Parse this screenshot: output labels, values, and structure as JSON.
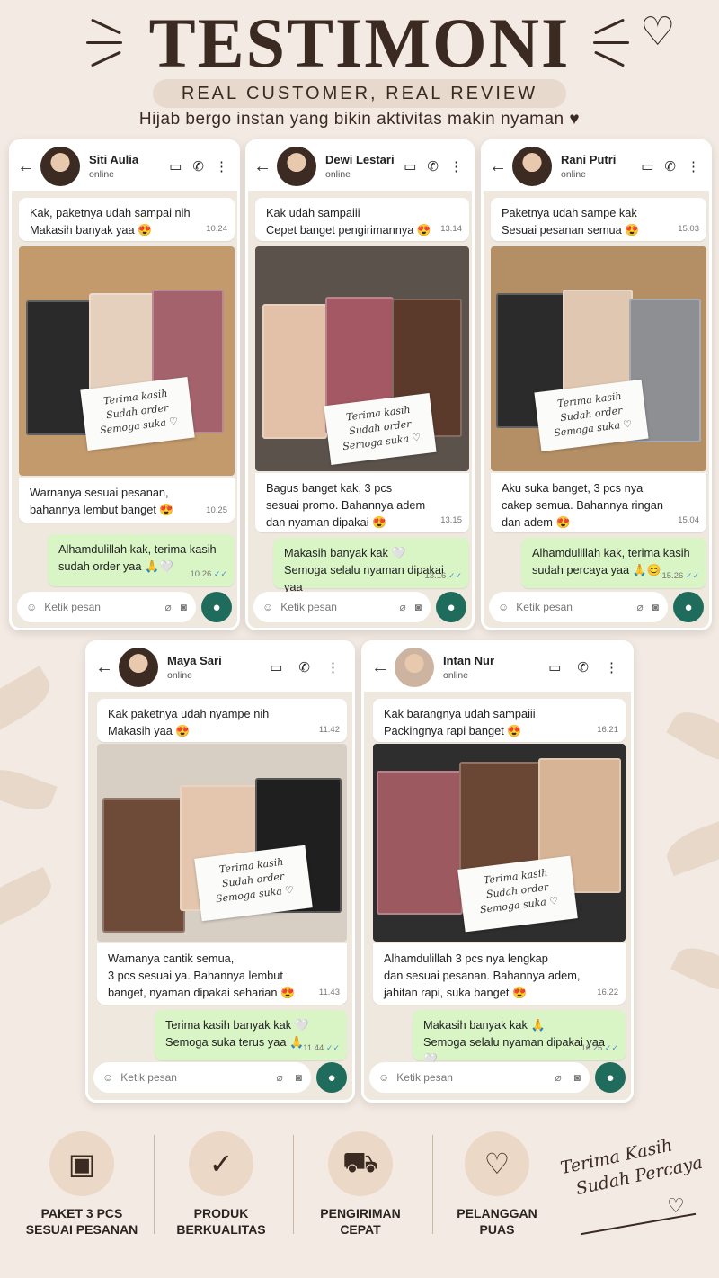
{
  "header": {
    "title": "TESTIMONI",
    "subtitle": "REAL CUSTOMER, REAL REVIEW",
    "tagline": "Hijab bergo instan yang bikin aktivitas makin nyaman ♥"
  },
  "colors": {
    "accent": "#3a2a22",
    "chat_bg": "#efe8df",
    "outgoing_bubble": "#d9f5c6",
    "mic_button": "#1f6b5c",
    "feature_circle": "#ecd8c6"
  },
  "chats": [
    {
      "name": "Siti Aulia",
      "status": "online",
      "msg1": {
        "line1": "Kak, paketnya udah sampai nih",
        "line2": "Makasih banyak yaa 😍",
        "time": "10.24"
      },
      "photo_note": {
        "l1": "Terima kasih",
        "l2": "Sudah order",
        "l3": "Semoga suka ♡"
      },
      "msg2": {
        "line1": "Warnanya sesuai pesanan,",
        "line2": "bahannya lembut banget 😍",
        "time": "10.25"
      },
      "reply": {
        "line1": "Alhamdulillah kak, terima kasih",
        "line2": "sudah order yaa 🙏🤍",
        "time": "10.26"
      },
      "input_placeholder": "Ketik pesan"
    },
    {
      "name": "Dewi Lestari",
      "status": "online",
      "msg1": {
        "line1": "Kak udah sampaiii",
        "line2": "Cepet banget pengirimannya 😍",
        "time": "13.14"
      },
      "photo_note": {
        "l1": "Terima kasih",
        "l2": "Sudah order",
        "l3": "Semoga suka ♡"
      },
      "msg2": {
        "line1": "Bagus banget kak, 3 pcs",
        "line2": "sesuai promo. Bahannya adem",
        "line3": "dan nyaman dipakai 😍",
        "time": "13.15"
      },
      "reply": {
        "line1": "Makasih banyak kak 🤍",
        "line2": "Semoga selalu nyaman dipakai yaa",
        "time": "13.16"
      },
      "input_placeholder": "Ketik pesan"
    },
    {
      "name": "Rani Putri",
      "status": "online",
      "msg1": {
        "line1": "Paketnya udah sampe kak",
        "line2": "Sesuai pesanan semua 😍",
        "time": "15.03"
      },
      "photo_note": {
        "l1": "Terima kasih",
        "l2": "Sudah order",
        "l3": "Semoga suka ♡"
      },
      "msg2": {
        "line1": "Aku suka banget, 3 pcs nya",
        "line2": "cakep semua. Bahannya ringan",
        "line3": "dan adem 😍",
        "time": "15.04"
      },
      "reply": {
        "line1": "Alhamdulillah kak, terima kasih",
        "line2": "sudah percaya yaa 🙏😊",
        "time": "15.26"
      },
      "input_placeholder": "Ketik pesan"
    },
    {
      "name": "Maya Sari",
      "status": "online",
      "msg1": {
        "line1": "Kak paketnya udah nyampe nih",
        "line2": "Makasih yaa 😍",
        "time": "11.42"
      },
      "photo_note": {
        "l1": "Terima kasih",
        "l2": "Sudah order",
        "l3": "Semoga suka ♡"
      },
      "msg2": {
        "line1": "Warnanya cantik semua,",
        "line2": "3 pcs sesuai ya. Bahannya lembut",
        "line3": "banget, nyaman dipakai seharian 😍",
        "time": "11.43"
      },
      "reply": {
        "line1": "Terima kasih banyak kak 🤍",
        "line2": "Semoga suka terus yaa 🙏",
        "time": "11.44"
      },
      "input_placeholder": "Ketik pesan"
    },
    {
      "name": "Intan Nur",
      "status": "online",
      "msg1": {
        "line1": "Kak barangnya udah sampaiii",
        "line2": "Packingnya rapi banget 😍",
        "time": "16.21"
      },
      "photo_note": {
        "l1": "Terima kasih",
        "l2": "Sudah order",
        "l3": "Semoga suka ♡"
      },
      "msg2": {
        "line1": "Alhamdulillah 3 pcs nya lengkap",
        "line2": "dan sesuai pesanan. Bahannya adem,",
        "line3": "jahitan rapi, suka banget 😍",
        "time": "16.22"
      },
      "reply": {
        "line1": "Makasih banyak kak 🙏",
        "line2": "Semoga selalu nyaman dipakai yaa 🤍",
        "time": "16.25"
      },
      "input_placeholder": "Ketik pesan"
    }
  ],
  "features": [
    {
      "icon": "box-icon",
      "line1": "PAKET 3 PCS",
      "line2": "SESUAI PESANAN"
    },
    {
      "icon": "shield-check-icon",
      "line1": "PRODUK",
      "line2": "BERKUALITAS"
    },
    {
      "icon": "truck-icon",
      "line1": "PENGIRIMAN",
      "line2": "CEPAT"
    },
    {
      "icon": "heart-icon",
      "line1": "PELANGGAN",
      "line2": "PUAS"
    }
  ],
  "closing": {
    "line1": "Terima Kasih",
    "line2": "Sudah Percaya"
  }
}
